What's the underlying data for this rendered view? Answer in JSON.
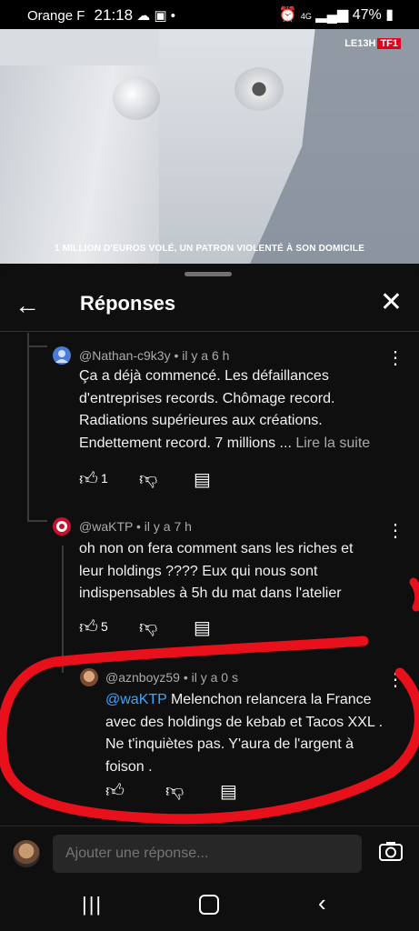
{
  "status_bar": {
    "carrier": "Orange F",
    "time": "21:18",
    "network": "4G",
    "battery": "47%"
  },
  "video": {
    "channel_logo_prefix": "LE13H",
    "channel_logo_brand": "TF1",
    "caption": "1 MILLION D'EUROS VOLÉ, UN PATRON VIOLENTÉ À SON DOMICILE",
    "progress": 0.43
  },
  "header": {
    "title": "Réponses"
  },
  "comments": [
    {
      "author": "@Nathan-c9k3y",
      "time": "il y a 6 h",
      "text": "Ça a déjà commencé. Les défaillances d'entreprises records. Chômage record. Radiations supérieures aux créations. Endettement record. 7 millions ...",
      "read_more": "Lire la suite",
      "likes": "1"
    },
    {
      "author": "@waKTP",
      "time": "il y a 7 h",
      "text": "oh non on fera comment sans les riches et leur holdings ???? Eux qui nous sont indispensables à 5h du mat dans l'atelier",
      "likes": "5"
    },
    {
      "author": "@aznboyz59",
      "time": "il y a 0 s",
      "mention": "@waKTP",
      "text": " Melenchon relancera la France avec des holdings de kebab et Tacos XXL . Ne t'inquiètes pas. Y'aura de l'argent à foison ."
    }
  ],
  "meta_separator": "•",
  "composer": {
    "placeholder": "Ajouter une réponse..."
  },
  "colors": {
    "background": "#0f0f0f",
    "mention": "#3ea6ff",
    "annotation": "#e8101a"
  },
  "icons": {
    "back": "arrow-left-icon",
    "close": "close-icon",
    "more": "more-vertical-icon",
    "like": "thumb-up-icon",
    "dislike": "thumb-down-icon",
    "reply": "reply-icon",
    "camera": "camera-icon"
  }
}
